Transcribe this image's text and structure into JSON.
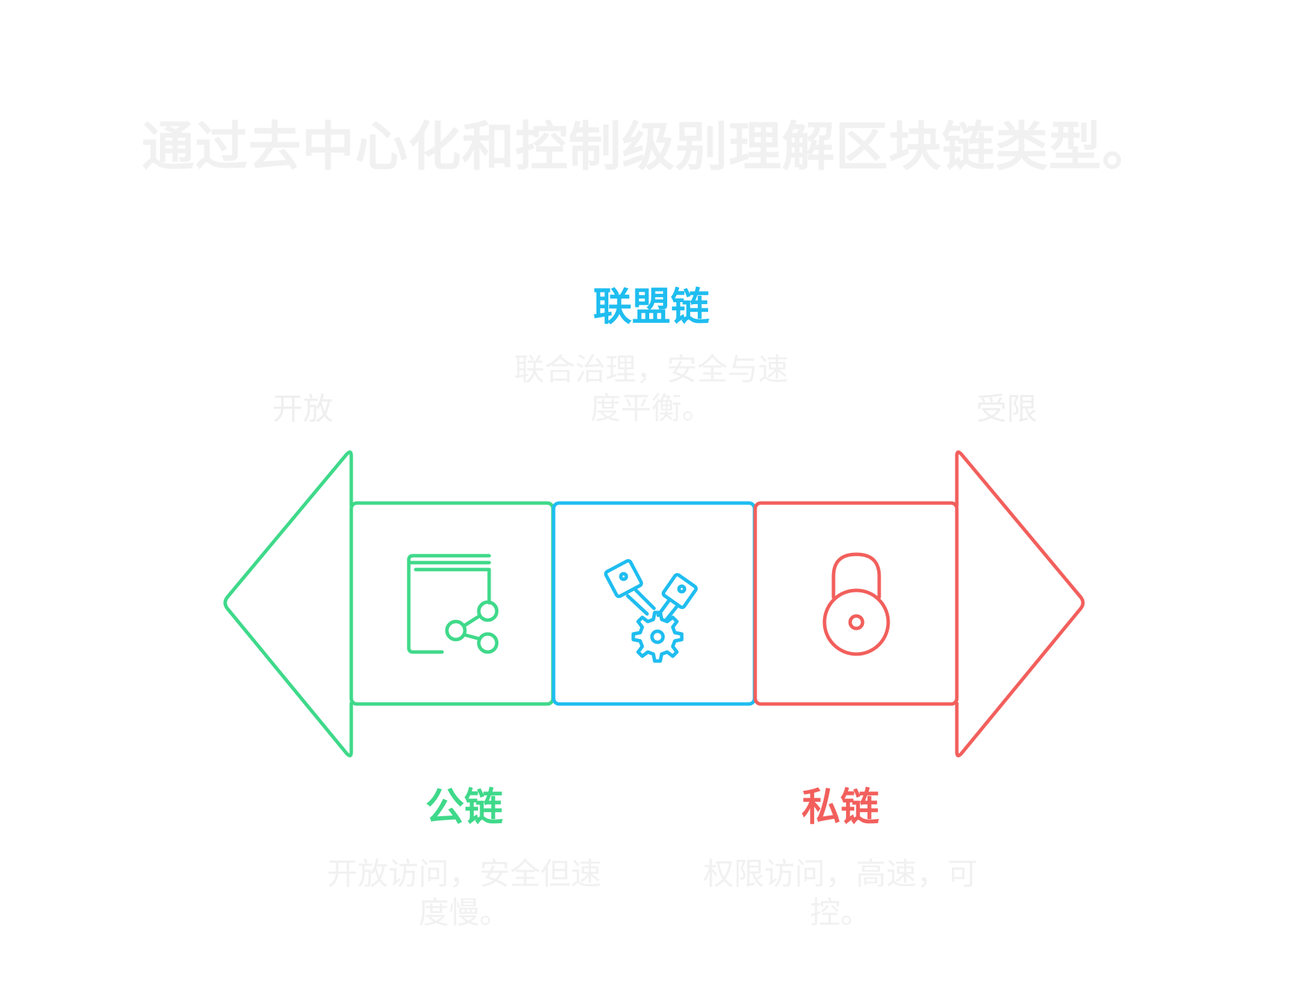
{
  "title": "通过去中心化和控制级别理解区块链类型。",
  "scale": {
    "left_label": "开放",
    "right_label": "受限"
  },
  "categories": [
    {
      "key": "public",
      "title": "公链",
      "description": "开放访问，安全但速度慢。",
      "color": "#3fd98a",
      "icon": "book-share-icon"
    },
    {
      "key": "consortium",
      "title": "联盟链",
      "description": "联合治理，安全与速度平衡。",
      "color": "#1fbdf0",
      "icon": "gear-pistons-icon"
    },
    {
      "key": "private",
      "title": "私链",
      "description": "权限访问，高速，可控。",
      "color": "#f25f5c",
      "icon": "padlock-icon"
    }
  ]
}
